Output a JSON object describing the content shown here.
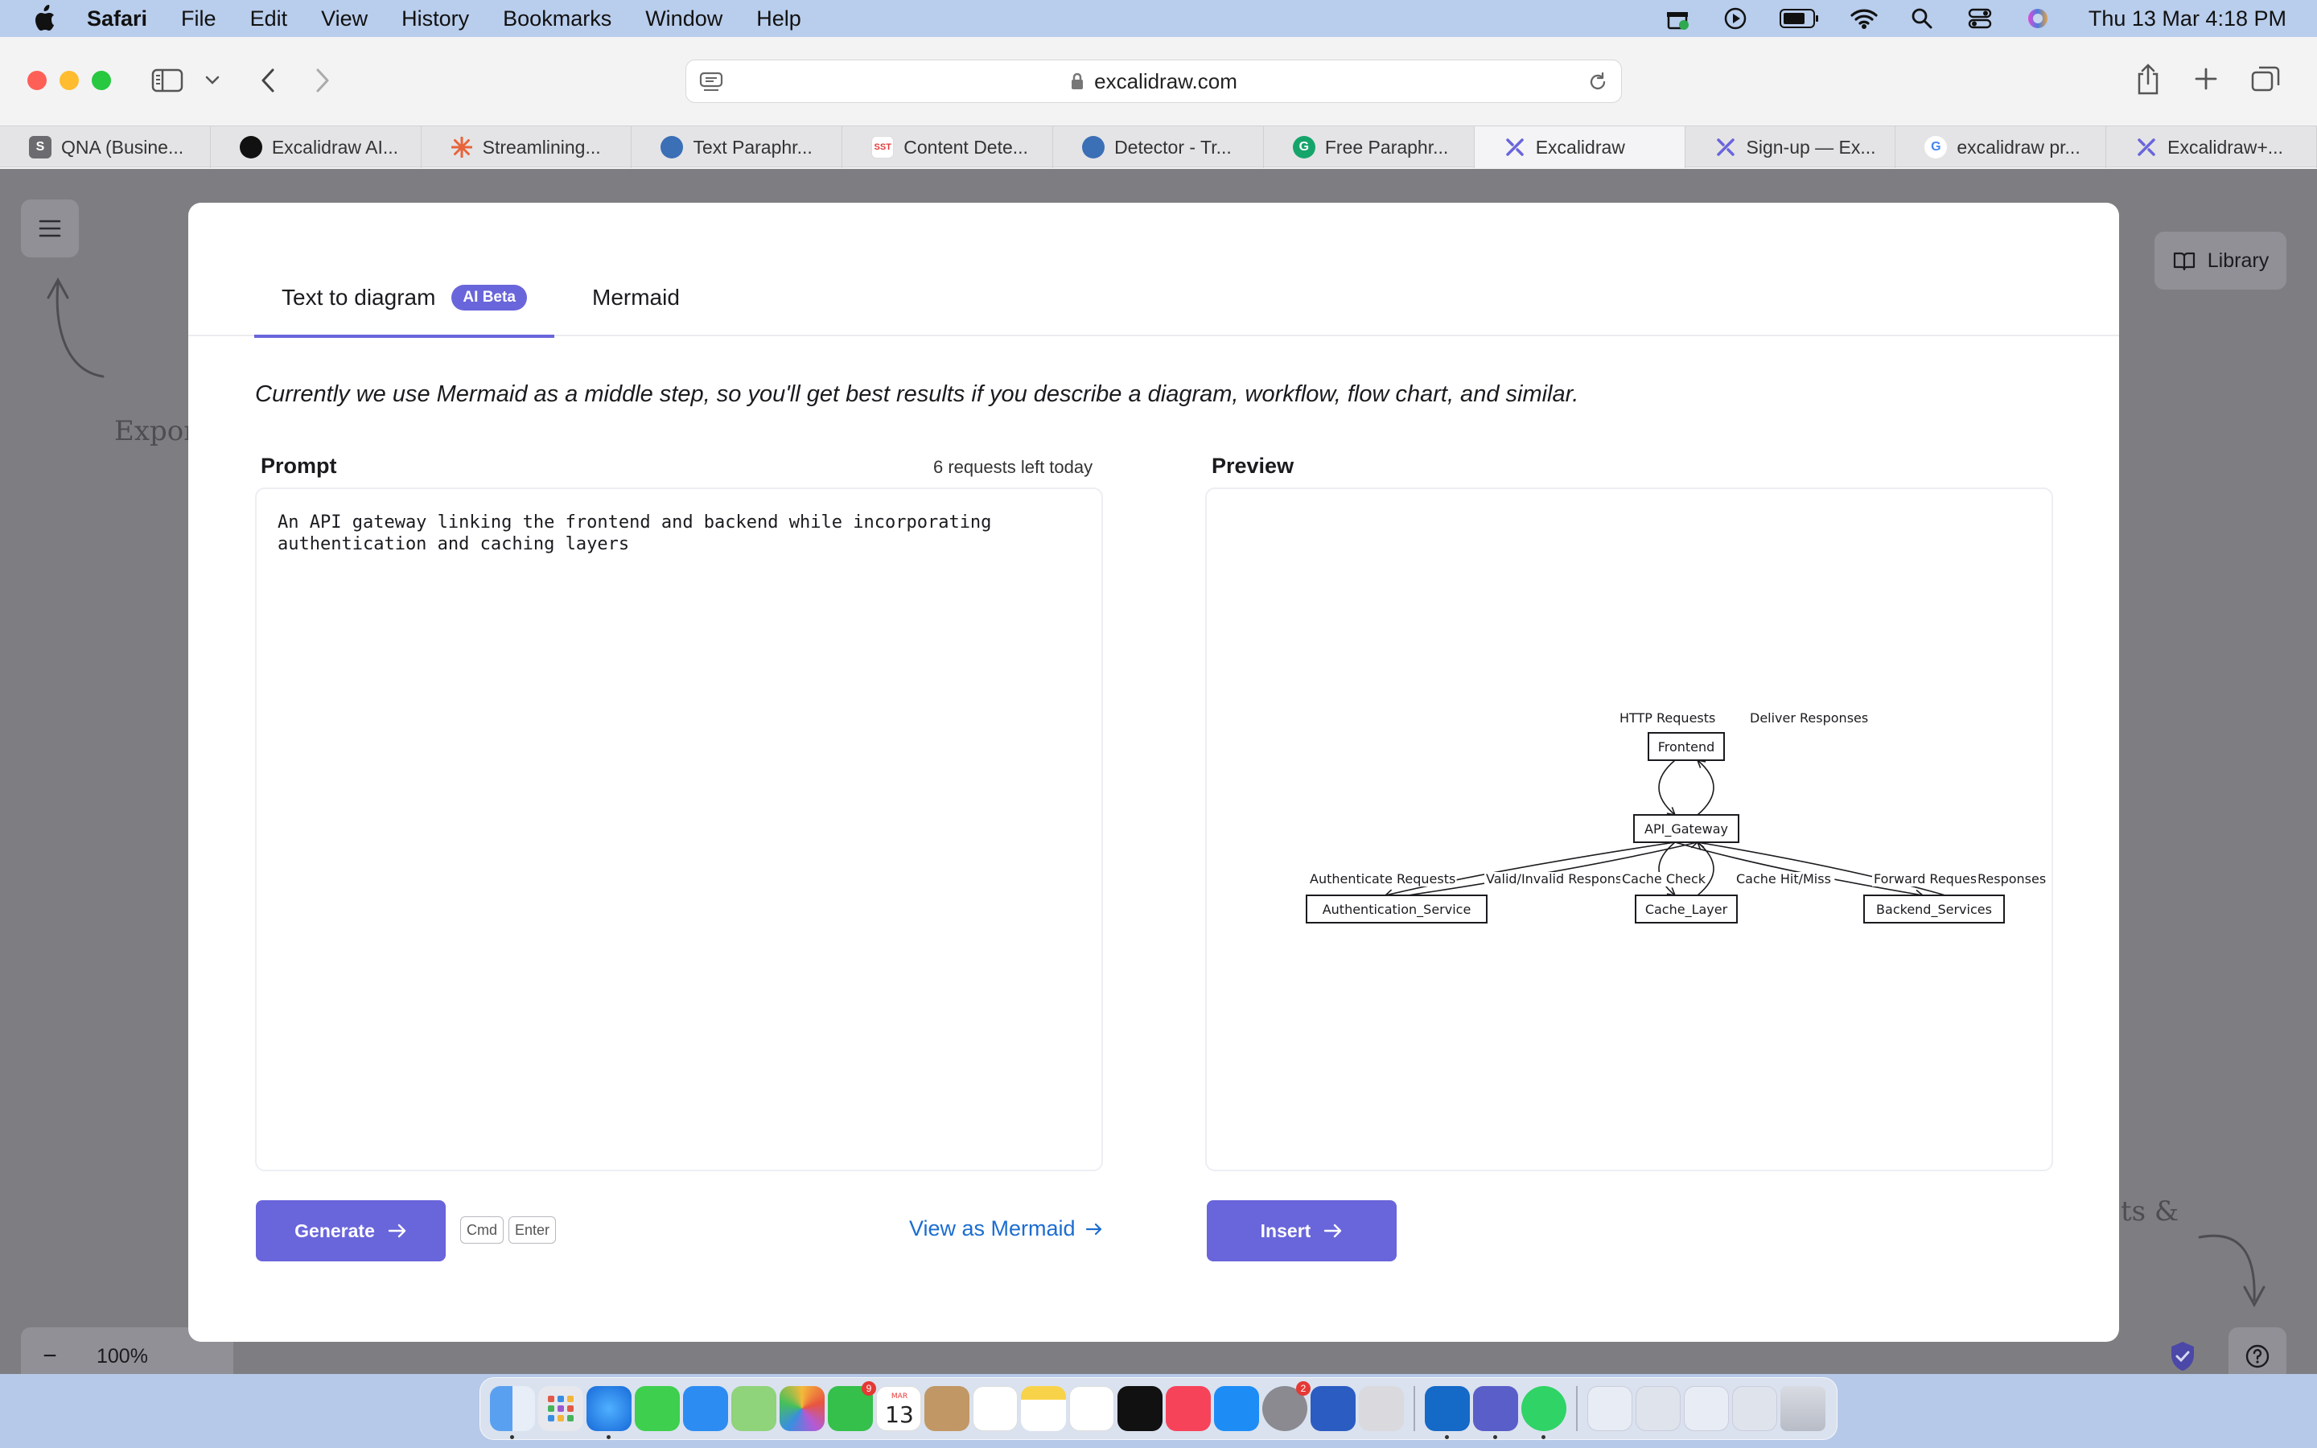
{
  "menubar": {
    "app": "Safari",
    "items": [
      "File",
      "Edit",
      "View",
      "History",
      "Bookmarks",
      "Window",
      "Help"
    ],
    "clock": "Thu 13 Mar  4:18 PM"
  },
  "browser": {
    "url": "excalidraw.com",
    "tabs": [
      {
        "label": "QNA (Busine...",
        "icon_text": "S",
        "color": "#6c6c70"
      },
      {
        "label": "Excalidraw AI...",
        "icon_text": "",
        "color": "#111111"
      },
      {
        "label": "Streamlining...",
        "icon_text": "",
        "color": "#e8633a"
      },
      {
        "label": "Text Paraphr...",
        "icon_text": "",
        "color": "#3b6fb6"
      },
      {
        "label": "Content Dete...",
        "icon_text": "SST",
        "color": "#e23b3b"
      },
      {
        "label": "Detector - Tr...",
        "icon_text": "",
        "color": "#3b6fb6"
      },
      {
        "label": "Free Paraphr...",
        "icon_text": "G",
        "color": "#15a56b"
      },
      {
        "label": "Excalidraw",
        "icon_text": "",
        "color": "#6965db"
      },
      {
        "label": "Sign-up — Ex...",
        "icon_text": "",
        "color": "#6965db"
      },
      {
        "label": "excalidraw pr...",
        "icon_text": "G",
        "color": "#4285f4"
      },
      {
        "label": "Excalidraw+...",
        "icon_text": "",
        "color": "#6965db"
      }
    ],
    "active_tab_index": 7
  },
  "background": {
    "export_hint": "Expor",
    "shortcuts_hint": "ts &",
    "library_label": "Library",
    "zoom_level": "100%",
    "zoom_out": "−"
  },
  "dialog": {
    "tabs": [
      {
        "label": "Text to diagram",
        "badge": "AI Beta"
      },
      {
        "label": "Mermaid"
      }
    ],
    "notice": "Currently we use Mermaid as a middle step, so you'll get best results if you describe a diagram, workflow, flow chart, and similar.",
    "prompt": {
      "label": "Prompt",
      "requests_left": "6 requests left today",
      "value": "An API gateway linking the frontend and backend while incorporating authentication and caching layers"
    },
    "preview": {
      "label": "Preview",
      "diagram": {
        "nodes": [
          "Frontend",
          "API_Gateway",
          "Authentication_Service",
          "Cache_Layer",
          "Backend_Services"
        ],
        "edges": [
          {
            "from": "Frontend",
            "to": "API_Gateway",
            "label": "HTTP Requests"
          },
          {
            "from": "API_Gateway",
            "to": "Frontend",
            "label": "Deliver Responses"
          },
          {
            "from": "API_Gateway",
            "to": "Authentication_Service",
            "label": "Authenticate Requests"
          },
          {
            "from": "Authentication_Service",
            "to": "API_Gateway",
            "label": "Valid/Invalid Response"
          },
          {
            "from": "API_Gateway",
            "to": "Cache_Layer",
            "label": "Cache Check"
          },
          {
            "from": "Cache_Layer",
            "to": "API_Gateway",
            "label": "Cache Hit/Miss"
          },
          {
            "from": "API_Gateway",
            "to": "Backend_Services",
            "label": "Forward Requests"
          },
          {
            "from": "Backend_Services",
            "to": "API_Gateway",
            "label": "Responses"
          }
        ]
      }
    },
    "generate_label": "Generate",
    "shortcut_keys": [
      "Cmd",
      "Enter"
    ],
    "view_mermaid_label": "View as Mermaid",
    "insert_label": "Insert"
  },
  "colors": {
    "accent": "#6965db",
    "link": "#1c6dd0"
  }
}
